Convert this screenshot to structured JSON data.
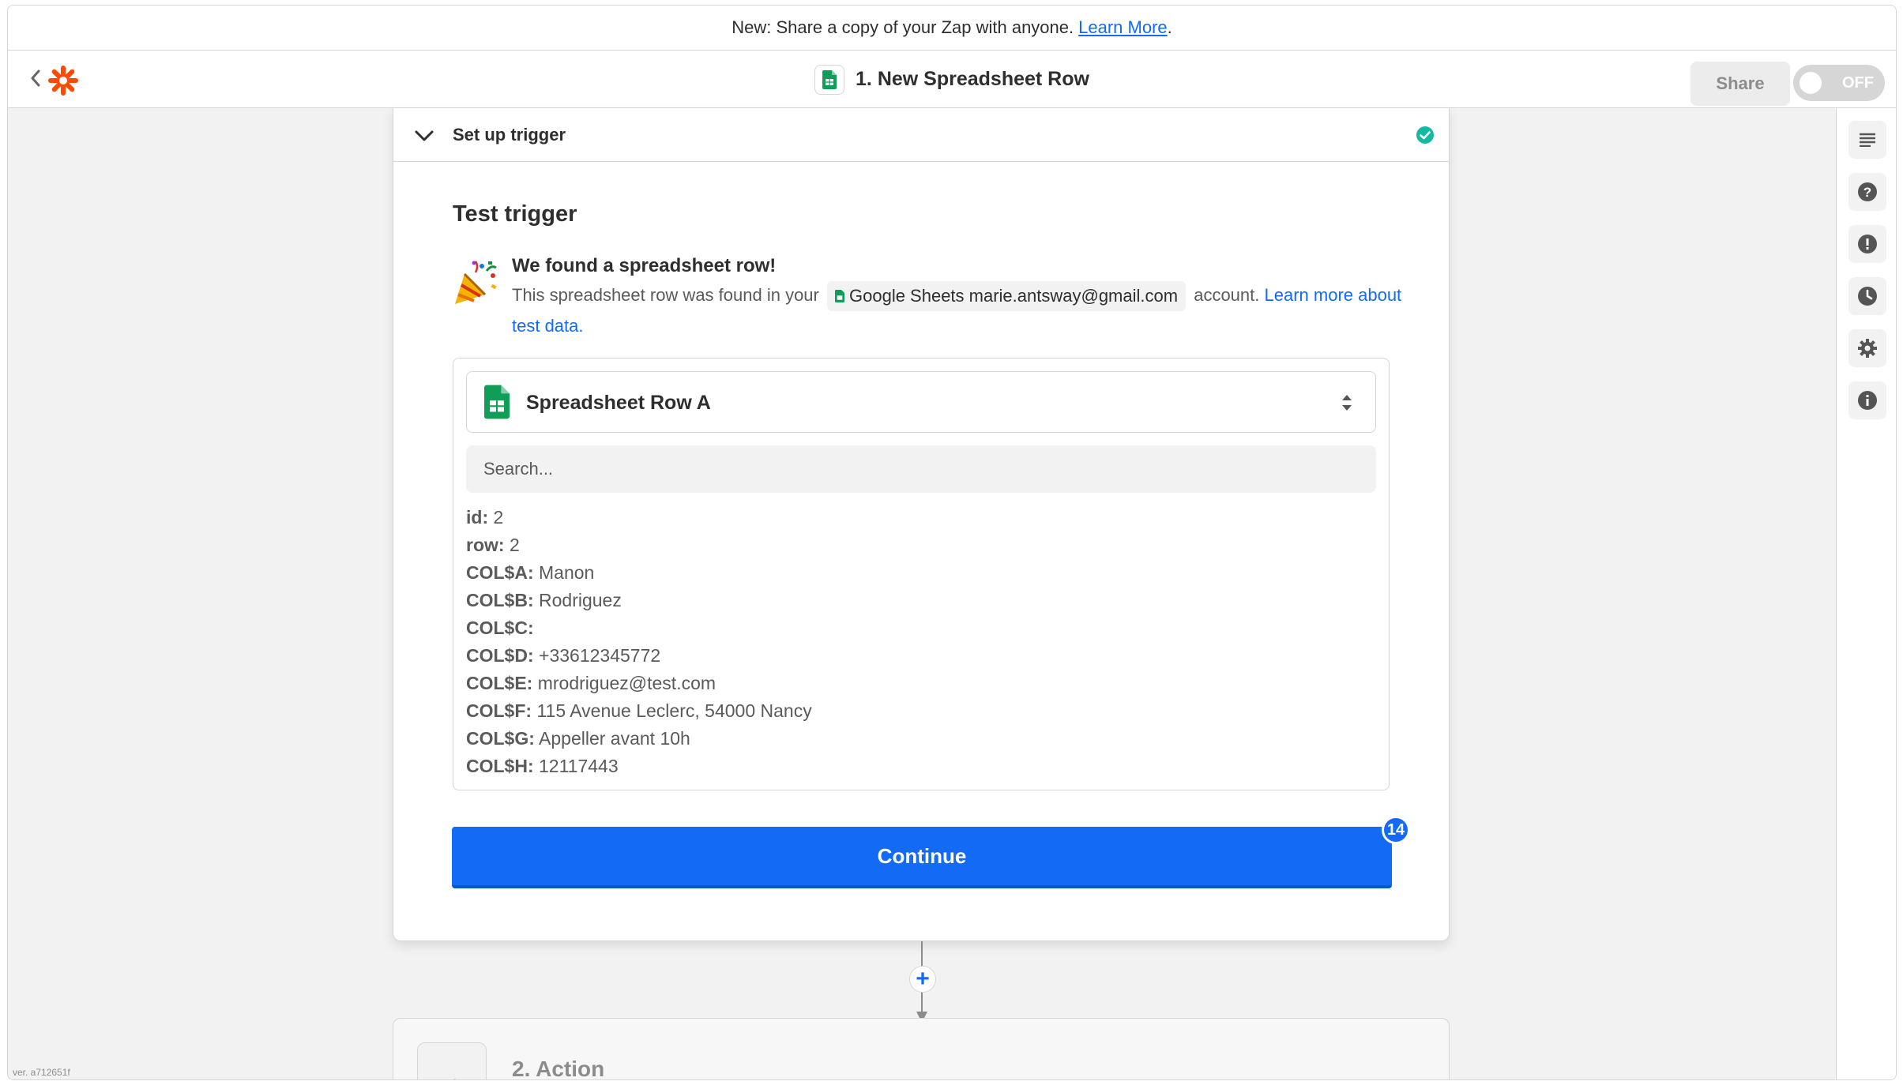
{
  "announcement": {
    "text": "New: Share a copy of your Zap with anyone.",
    "link": "Learn More",
    "period": "."
  },
  "header": {
    "zap_title": "1. New Spreadsheet Row",
    "share_label": "Share",
    "toggle_label": "OFF"
  },
  "step": {
    "section_label": "Set up trigger",
    "test_title": "Test trigger",
    "found_title": "We found a spreadsheet row!",
    "found_text_before": "This spreadsheet row was found in your",
    "account_chip": "Google Sheets marie.antsway@gmail.com",
    "found_text_after": "account.",
    "learn_more": "Learn more about test data."
  },
  "data_box": {
    "selector_label": "Spreadsheet Row A",
    "search_placeholder": "Search...",
    "fields": [
      {
        "key": "id:",
        "value": "2"
      },
      {
        "key": "row:",
        "value": "2"
      },
      {
        "key": "COL$A:",
        "value": "Manon"
      },
      {
        "key": "COL$B:",
        "value": "Rodriguez"
      },
      {
        "key": "COL$C:",
        "value": ""
      },
      {
        "key": "COL$D:",
        "value": "+33612345772"
      },
      {
        "key": "COL$E:",
        "value": "mrodriguez@test.com"
      },
      {
        "key": "COL$F:",
        "value": "115 Avenue Leclerc, 54000 Nancy"
      },
      {
        "key": "COL$G:",
        "value": "Appeller avant 10h"
      },
      {
        "key": "COL$H:",
        "value": "12117443"
      }
    ]
  },
  "continue_label": "Continue",
  "badge_count": "14",
  "add_step": "+",
  "next_step": {
    "title": "2. Action"
  },
  "version": "ver. a712651f",
  "icons": {
    "sidebar": [
      "outline-icon",
      "help-icon",
      "alert-icon",
      "history-icon",
      "settings-icon",
      "info-icon"
    ]
  },
  "colors": {
    "brand": "#ff4a00",
    "primary": "#136bf5",
    "success": "#13b9a0",
    "sheets": "#0f9d58"
  }
}
